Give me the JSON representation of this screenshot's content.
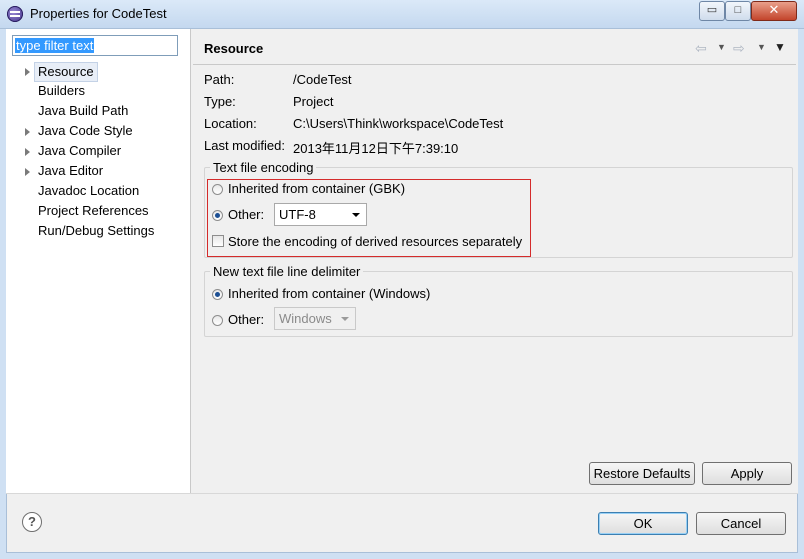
{
  "window": {
    "title": "Properties for CodeTest",
    "minimize_glyph": "▭",
    "maximize_glyph": "□",
    "close_glyph": "✕"
  },
  "filter": {
    "value": "type filter text"
  },
  "tree": {
    "items": [
      {
        "label": "Resource",
        "expandable": true,
        "selected": true
      },
      {
        "label": "Builders",
        "expandable": false
      },
      {
        "label": "Java Build Path",
        "expandable": false
      },
      {
        "label": "Java Code Style",
        "expandable": true
      },
      {
        "label": "Java Compiler",
        "expandable": true
      },
      {
        "label": "Java Editor",
        "expandable": true
      },
      {
        "label": "Javadoc Location",
        "expandable": false
      },
      {
        "label": "Project References",
        "expandable": false
      },
      {
        "label": "Run/Debug Settings",
        "expandable": false
      }
    ]
  },
  "page": {
    "title": "Resource",
    "info": [
      {
        "label": "Path:",
        "value": "/CodeTest"
      },
      {
        "label": "Type:",
        "value": "Project"
      },
      {
        "label": "Location:",
        "value": "C:\\Users\\Think\\workspace\\CodeTest"
      },
      {
        "label": "Last modified:",
        "value": "2013年11月12日下午7:39:10"
      }
    ],
    "encoding_group": {
      "title": "Text file encoding",
      "inherited_label": "Inherited from container (GBK)",
      "other_label": "Other:",
      "other_value": "UTF-8",
      "store_label": "Store the encoding of derived resources separately"
    },
    "delimiter_group": {
      "title": "New text file line delimiter",
      "inherited_label": "Inherited from container (Windows)",
      "other_label": "Other:",
      "other_value": "Windows"
    },
    "restore_defaults_label": "Restore Defaults",
    "apply_label": "Apply"
  },
  "footer": {
    "help_glyph": "?",
    "ok_label": "OK",
    "cancel_label": "Cancel"
  },
  "colors": {
    "selection_highlight": "#3399ff",
    "annotation_box": "#d42b2b"
  }
}
